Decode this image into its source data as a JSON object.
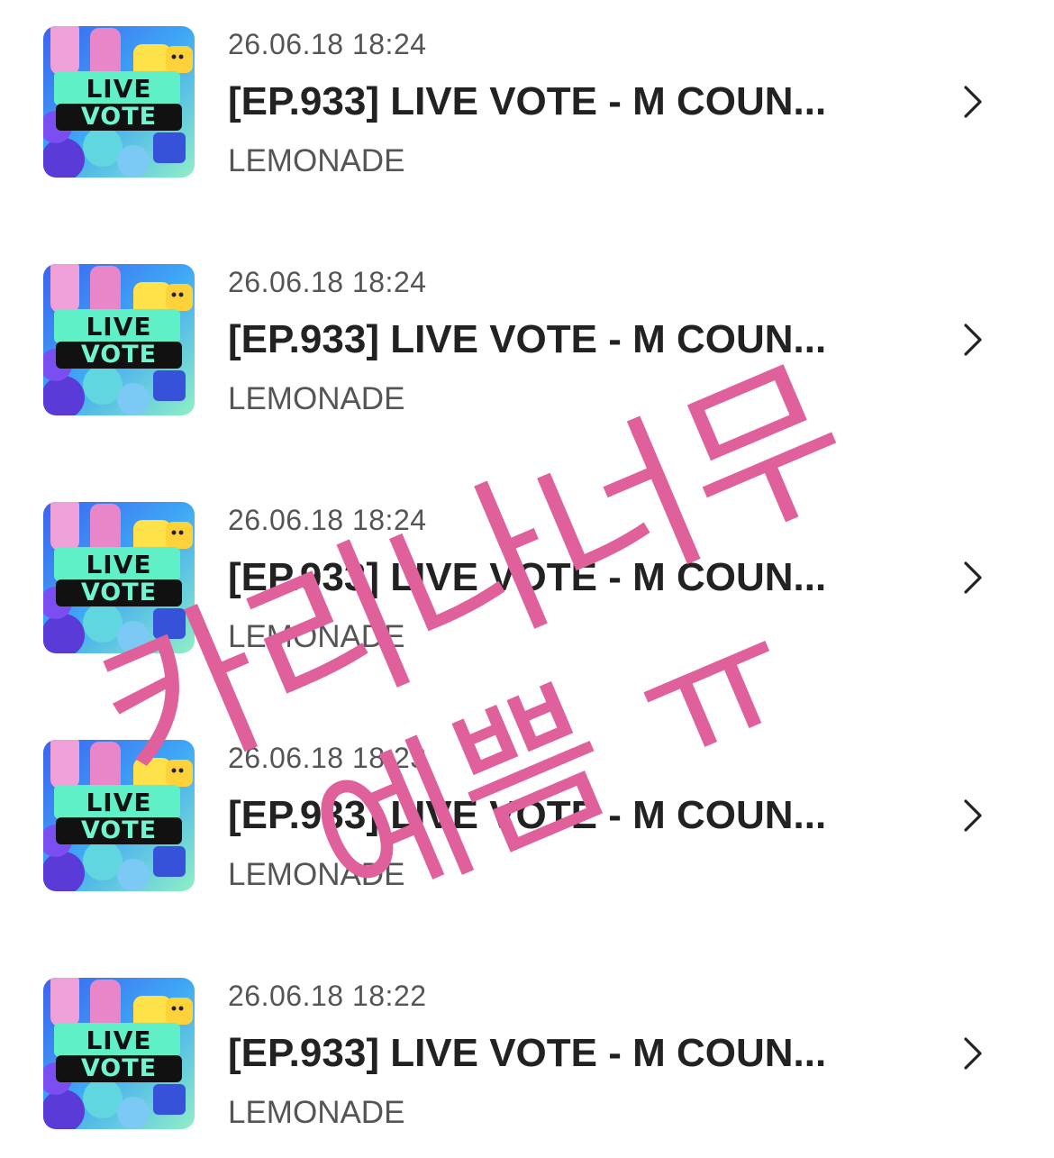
{
  "items": [
    {
      "date": "26.06.18 18:24",
      "title": "[EP.933] LIVE VOTE - M COUN...",
      "artist": "LEMONADE",
      "thumb_text_1": "LIVE",
      "thumb_text_2": "VOTE"
    },
    {
      "date": "26.06.18 18:24",
      "title": "[EP.933] LIVE VOTE - M COUN...",
      "artist": "LEMONADE",
      "thumb_text_1": "LIVE",
      "thumb_text_2": "VOTE"
    },
    {
      "date": "26.06.18 18:24",
      "title": "[EP.933] LIVE VOTE - M COUN...",
      "artist": "LEMONADE",
      "thumb_text_1": "LIVE",
      "thumb_text_2": "VOTE"
    },
    {
      "date": "26.06.18 18:23",
      "title": "[EP.933] LIVE VOTE - M COUN...",
      "artist": "LEMONADE",
      "thumb_text_1": "LIVE",
      "thumb_text_2": "VOTE"
    },
    {
      "date": "26.06.18 18:22",
      "title": "[EP.933] LIVE VOTE - M COUN...",
      "artist": "LEMONADE",
      "thumb_text_1": "LIVE",
      "thumb_text_2": "VOTE"
    }
  ],
  "icons": {
    "row_arrow": "chevron-right-icon",
    "thumbnail": "live-vote-thumbnail"
  },
  "overlay": {
    "line1": "카리나너무",
    "line2": "예쁨 ㅠ",
    "color": "#e0609b"
  }
}
